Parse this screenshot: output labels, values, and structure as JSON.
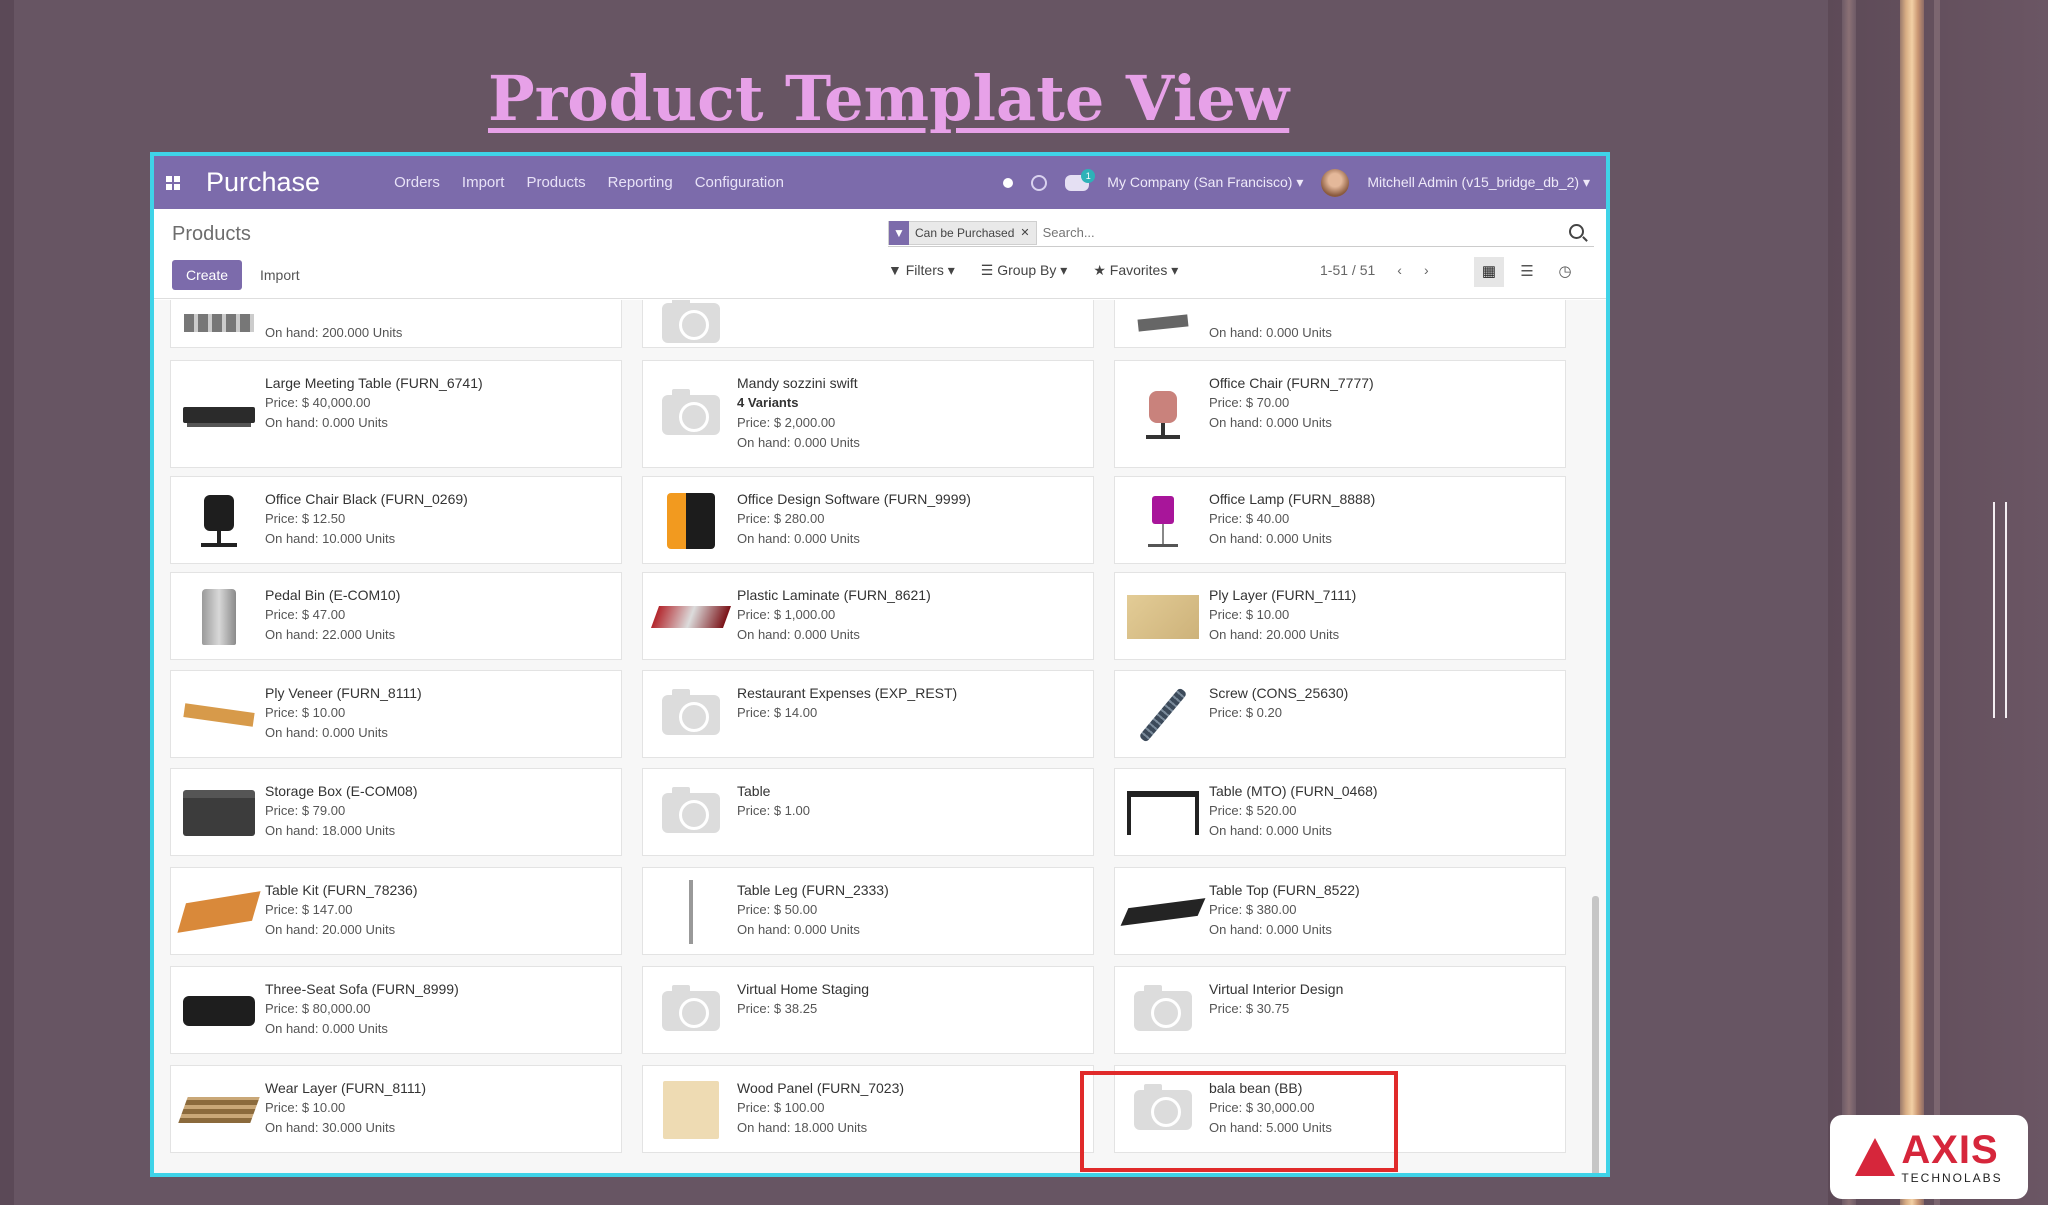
{
  "slide": {
    "title": "Product Template View",
    "logo": {
      "main": "AXIS",
      "sub": "TECHNOLABS",
      "color": "#d6263b"
    }
  },
  "navbar": {
    "brand": "Purchase",
    "menu": [
      "Orders",
      "Import",
      "Products",
      "Reporting",
      "Configuration"
    ],
    "chat_count": "1",
    "company": "My Company (San Francisco)",
    "user": "Mitchell Admin (v15_bridge_db_2)",
    "accent": "#7c6bab"
  },
  "control": {
    "breadcrumb": "Products",
    "create_label": "Create",
    "import_label": "Import",
    "facet": "Can be Purchased",
    "search_placeholder": "Search...",
    "filters_label": "Filters",
    "groupby_label": "Group By",
    "favorites_label": "Favorites",
    "pager": "1-51 / 51"
  },
  "products": [
    {
      "name": "",
      "lines": [
        "On hand: 200.000 Units"
      ],
      "img": "boxes"
    },
    {
      "name": "",
      "lines": [],
      "img": "placeholder"
    },
    {
      "name": "",
      "lines": [
        "On hand: 0.000 Units"
      ],
      "img": "hardware"
    },
    {
      "name": "Large Meeting Table (FURN_6741)",
      "lines": [
        "Price: $ 40,000.00",
        "On hand: 0.000 Units"
      ],
      "img": "meeting-table"
    },
    {
      "name": "Mandy sozzini swift",
      "bold": "4 Variants",
      "lines": [
        "Price: $ 2,000.00",
        "On hand: 0.000 Units"
      ],
      "img": "placeholder"
    },
    {
      "name": "Office Chair (FURN_7777)",
      "lines": [
        "Price: $ 70.00",
        "On hand: 0.000 Units"
      ],
      "img": "office-chair"
    },
    {
      "name": "Office Chair Black (FURN_0269)",
      "lines": [
        "Price: $ 12.50",
        "On hand: 10.000 Units"
      ],
      "img": "chair-black"
    },
    {
      "name": "Office Design Software (FURN_9999)",
      "lines": [
        "Price: $ 280.00",
        "On hand: 0.000 Units"
      ],
      "img": "software"
    },
    {
      "name": "Office Lamp (FURN_8888)",
      "lines": [
        "Price: $ 40.00",
        "On hand: 0.000 Units"
      ],
      "img": "lamp"
    },
    {
      "name": "Pedal Bin (E-COM10)",
      "lines": [
        "Price: $ 47.00",
        "On hand: 22.000 Units"
      ],
      "img": "bin"
    },
    {
      "name": "Plastic Laminate (FURN_8621)",
      "lines": [
        "Price: $ 1,000.00",
        "On hand: 0.000 Units"
      ],
      "img": "laminate"
    },
    {
      "name": "Ply Layer (FURN_7111)",
      "lines": [
        "Price: $ 10.00",
        "On hand: 20.000 Units"
      ],
      "img": "ply-layer"
    },
    {
      "name": "Ply Veneer (FURN_8111)",
      "lines": [
        "Price: $ 10.00",
        "On hand: 0.000 Units"
      ],
      "img": "veneer"
    },
    {
      "name": "Restaurant Expenses (EXP_REST)",
      "lines": [
        "Price: $ 14.00"
      ],
      "img": "placeholder"
    },
    {
      "name": "Screw (CONS_25630)",
      "lines": [
        "Price: $ 0.20"
      ],
      "img": "screw"
    },
    {
      "name": "Storage Box (E-COM08)",
      "lines": [
        "Price: $ 79.00",
        "On hand: 18.000 Units"
      ],
      "img": "storage-box"
    },
    {
      "name": "Table",
      "lines": [
        "Price: $ 1.00"
      ],
      "img": "placeholder"
    },
    {
      "name": "Table (MTO) (FURN_0468)",
      "lines": [
        "Price: $ 520.00",
        "On hand: 0.000 Units"
      ],
      "img": "table"
    },
    {
      "name": "Table Kit (FURN_78236)",
      "lines": [
        "Price: $ 147.00",
        "On hand: 20.000 Units"
      ],
      "img": "table-kit"
    },
    {
      "name": "Table Leg (FURN_2333)",
      "lines": [
        "Price: $ 50.00",
        "On hand: 0.000 Units"
      ],
      "img": "table-leg"
    },
    {
      "name": "Table Top (FURN_8522)",
      "lines": [
        "Price: $ 380.00",
        "On hand: 0.000 Units"
      ],
      "img": "table-top"
    },
    {
      "name": "Three-Seat Sofa (FURN_8999)",
      "lines": [
        "Price: $ 80,000.00",
        "On hand: 0.000 Units"
      ],
      "img": "sofa"
    },
    {
      "name": "Virtual Home Staging",
      "lines": [
        "Price: $ 38.25"
      ],
      "img": "placeholder"
    },
    {
      "name": "Virtual Interior Design",
      "lines": [
        "Price: $ 30.75"
      ],
      "img": "placeholder"
    },
    {
      "name": "Wear Layer (FURN_8111)",
      "lines": [
        "Price: $ 10.00",
        "On hand: 30.000 Units"
      ],
      "img": "wear-layer"
    },
    {
      "name": "Wood Panel (FURN_7023)",
      "lines": [
        "Price: $ 100.00",
        "On hand: 18.000 Units"
      ],
      "img": "wood-panel"
    },
    {
      "name": "bala bean (BB)",
      "lines": [
        "Price: $ 30,000.00",
        "On hand: 5.000 Units"
      ],
      "img": "placeholder",
      "highlighted": true
    }
  ]
}
